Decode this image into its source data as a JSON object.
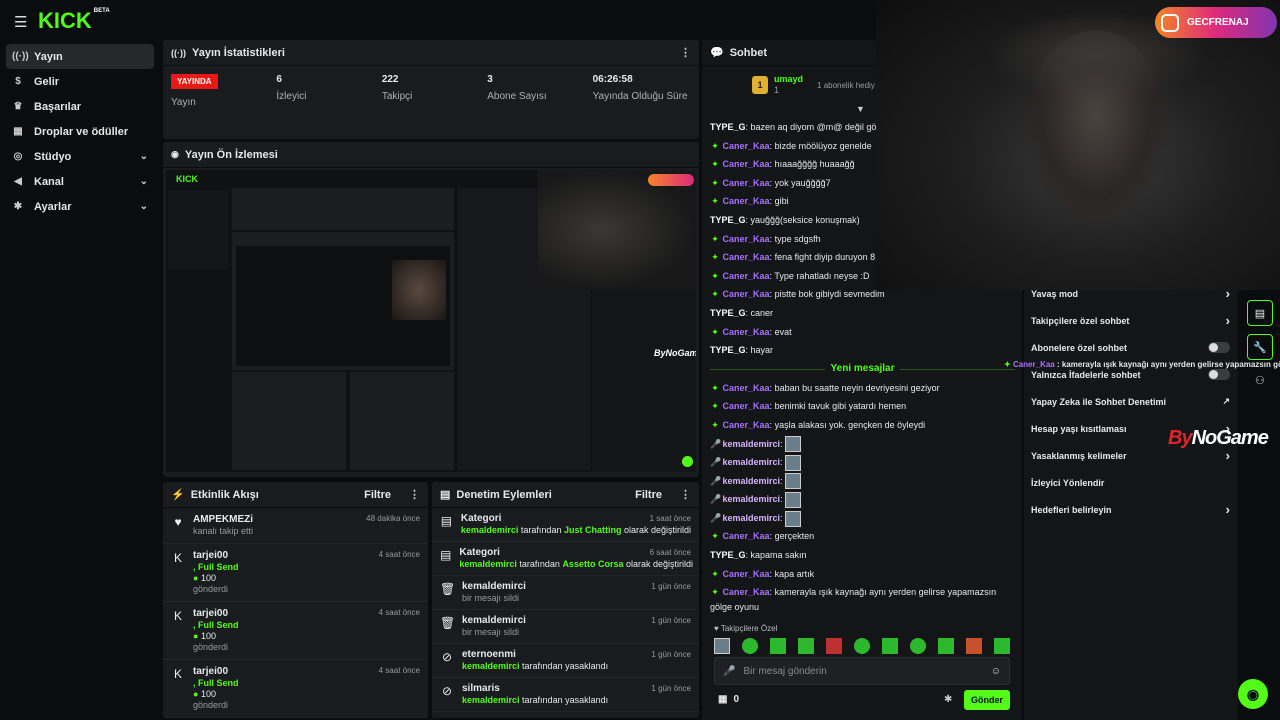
{
  "topbar": {
    "logo": "KICK",
    "logo_badge": "BETA"
  },
  "sidebar": {
    "items": [
      {
        "label": "Yayın",
        "icon": "broadcast-icon",
        "glyph": "((·))",
        "active": true,
        "chevron": false
      },
      {
        "label": "Gelir",
        "icon": "dollar-icon",
        "glyph": "$",
        "active": false,
        "chevron": false
      },
      {
        "label": "Başarılar",
        "icon": "trophy-icon",
        "glyph": "♛",
        "active": false,
        "chevron": false
      },
      {
        "label": "Droplar ve ödüller",
        "icon": "gift-icon",
        "glyph": "▦",
        "active": false,
        "chevron": false
      },
      {
        "label": "Stüdyo",
        "icon": "studio-icon",
        "glyph": "◎",
        "active": false,
        "chevron": true
      },
      {
        "label": "Kanal",
        "icon": "megaphone-icon",
        "glyph": "◀",
        "active": false,
        "chevron": true
      },
      {
        "label": "Ayarlar",
        "icon": "gear-icon",
        "glyph": "✱",
        "active": false,
        "chevron": true
      }
    ]
  },
  "stats": {
    "title": "Yayın İstatistikleri",
    "live_badge": "YAYINDA",
    "live_label": "Yayın",
    "items": [
      {
        "value": "6",
        "label": "İzleyici"
      },
      {
        "value": "222",
        "label": "Takipçi"
      },
      {
        "value": "3",
        "label": "Abone Sayısı"
      },
      {
        "value": "06:26:58",
        "label": "Yayında Olduğu Süre"
      }
    ]
  },
  "preview": {
    "title": "Yayın Ön İzlemesi"
  },
  "activity": {
    "title": "Etkinlik Akışı",
    "filter": "Filtre",
    "items": [
      {
        "name": "AMPEKMEZi",
        "line1": "kanalı takip etti",
        "line2": "",
        "line3": "",
        "time": "48 dakika önce",
        "icon": "heart-icon",
        "glyph": "♥"
      },
      {
        "name": "tarjei00",
        "line1": ", Full Send",
        "line2": "100",
        "line3": "gönderdi",
        "time": "4 saat önce",
        "icon": "kick-icon",
        "glyph": "K"
      },
      {
        "name": "tarjei00",
        "line1": ", Full Send",
        "line2": "100",
        "line3": "gönderdi",
        "time": "4 saat önce",
        "icon": "kick-icon",
        "glyph": "K"
      },
      {
        "name": "tarjei00",
        "line1": ", Full Send",
        "line2": "100",
        "line3": "gönderdi",
        "time": "4 saat önce",
        "icon": "kick-icon",
        "glyph": "K"
      }
    ]
  },
  "moderation": {
    "title": "Denetim Eylemleri",
    "filter": "Filtre",
    "items": [
      {
        "name": "Kategori",
        "user": "kemaldemirci",
        "mid": " tarafından ",
        "target": "Just Chatting",
        "tail": " olarak değiştirildi",
        "time": "1 saat önce",
        "icon": "category-icon",
        "glyph": "▤"
      },
      {
        "name": "Kategori",
        "user": "kemaldemirci",
        "mid": " tarafından ",
        "target": "Assetto Corsa",
        "tail": " olarak değiştirildi",
        "time": "6 saat önce",
        "icon": "category-icon",
        "glyph": "▤"
      },
      {
        "name": "kemaldemirci",
        "user": "",
        "mid": "bir mesajı sildi",
        "target": "",
        "tail": "",
        "time": "1 gün önce",
        "icon": "trash-icon",
        "glyph": "🗑"
      },
      {
        "name": "kemaldemirci",
        "user": "",
        "mid": "bir mesajı sildi",
        "target": "",
        "tail": "",
        "time": "1 gün önce",
        "icon": "trash-icon",
        "glyph": "🗑"
      },
      {
        "name": "eternoenmi",
        "user": "kemaldemirci",
        "mid": " tarafından yasaklandı",
        "target": "",
        "tail": "",
        "time": "1 gün önce",
        "icon": "ban-icon",
        "glyph": "⊘"
      },
      {
        "name": "silmaris",
        "user": "kemaldemirci",
        "mid": " tarafından yasaklandı",
        "target": "",
        "tail": "",
        "time": "1 gün önce",
        "icon": "ban-icon",
        "glyph": "⊘"
      }
    ]
  },
  "chat": {
    "title": "Sohbet",
    "pinned_user": "umayd",
    "pinned_count": "1",
    "pinned_text": "1 abonelik hediy",
    "new_messages": "Yeni mesajlar",
    "followers_only": "Takipçilere Özel",
    "input_placeholder": "Bir mesaj gönderin",
    "points": "0",
    "send": "Gönder",
    "messages_before": [
      {
        "user": "TYPE_G",
        "badge": "",
        "text": "bazen aq diyom @m@ değil göte",
        "color": "#ffffff"
      },
      {
        "user": "Caner_Kaa",
        "badge": "green",
        "text": "bizde möölüyoz genelde",
        "color": "#a970ff"
      },
      {
        "user": "Caner_Kaa",
        "badge": "green",
        "text": "hıaaağğğğ huaaağğ",
        "color": "#a970ff"
      },
      {
        "user": "Caner_Kaa",
        "badge": "green",
        "text": "yok yauğğğğ7",
        "color": "#a970ff"
      },
      {
        "user": "Caner_Kaa",
        "badge": "green",
        "text": "gibi",
        "color": "#a970ff"
      },
      {
        "user": "TYPE_G",
        "badge": "",
        "text": "yauğğğ(seksice konuşmak)",
        "color": "#ffffff"
      },
      {
        "user": "Caner_Kaa",
        "badge": "green",
        "text": "type sdgsfh",
        "color": "#a970ff"
      },
      {
        "user": "Caner_Kaa",
        "badge": "green",
        "text": "fena fight diyip duruyon 8",
        "color": "#a970ff"
      },
      {
        "user": "Caner_Kaa",
        "badge": "green",
        "text": "Type rahatladı neyse :D",
        "color": "#a970ff"
      },
      {
        "user": "Caner_Kaa",
        "badge": "green",
        "text": "pistte bok gibiydi sevmedim",
        "color": "#a970ff"
      },
      {
        "user": "TYPE_G",
        "badge": "",
        "text": "caner",
        "color": "#ffffff"
      },
      {
        "user": "Caner_Kaa",
        "badge": "green",
        "text": "evat",
        "color": "#a970ff"
      },
      {
        "user": "TYPE_G",
        "badge": "",
        "text": "hayar",
        "color": "#ffffff"
      }
    ],
    "messages_after": [
      {
        "user": "Caner_Kaa",
        "badge": "green",
        "text": "baban bu saatte neyin devriyesini geziyor",
        "color": "#a970ff"
      },
      {
        "user": "Caner_Kaa",
        "badge": "green",
        "text": "benimki tavuk gibi yatardı hemen",
        "color": "#a970ff"
      },
      {
        "user": "Caner_Kaa",
        "badge": "green",
        "text": "yaşla alakası yok. gençken de öyleydi",
        "color": "#a970ff"
      },
      {
        "user": "kemaldemirci",
        "badge": "mic",
        "text": "",
        "color": "#d6b3ff",
        "emote": true
      },
      {
        "user": "kemaldemirci",
        "badge": "mic",
        "text": "",
        "color": "#d6b3ff",
        "emote": true
      },
      {
        "user": "kemaldemirci",
        "badge": "mic",
        "text": "",
        "color": "#d6b3ff",
        "emote": true
      },
      {
        "user": "kemaldemirci",
        "badge": "mic",
        "text": "",
        "color": "#d6b3ff",
        "emote": true
      },
      {
        "user": "kemaldemirci",
        "badge": "mic",
        "text": "",
        "color": "#d6b3ff",
        "emote": true
      },
      {
        "user": "Caner_Kaa",
        "badge": "green",
        "text": "gerçekten",
        "color": "#a970ff"
      },
      {
        "user": "TYPE_G",
        "badge": "",
        "text": "kapama sakın",
        "color": "#ffffff"
      },
      {
        "user": "Caner_Kaa",
        "badge": "green",
        "text": "kapa artık",
        "color": "#a970ff"
      },
      {
        "user": "Caner_Kaa",
        "badge": "green",
        "text": "kamerayla ışık kaynağı aynı yerden gelirse yapamazsın",
        "color": "#a970ff"
      }
    ],
    "wrap_tail": "gölge oyunu"
  },
  "chat_settings": {
    "items": [
      {
        "label": "Yavaş mod",
        "control": "chevron"
      },
      {
        "label": "Takipçilere özel sohbet",
        "control": "chevron"
      },
      {
        "label": "Abonelere özel sohbet",
        "control": "toggle"
      },
      {
        "label": "Yalnızca İfadelerle sohbet",
        "control": "toggle"
      },
      {
        "label": "Yapay Zeka ile Sohbet Denetimi",
        "control": "external"
      },
      {
        "label": "Hesap yaşı kısıtlaması",
        "control": "chevron"
      },
      {
        "label": "Yasaklanmış kelimeler",
        "control": "chevron"
      },
      {
        "label": "İzleyici Yönlendir",
        "control": "none"
      },
      {
        "label": "Hedefleri belirleyin",
        "control": "chevron"
      }
    ]
  },
  "overlay": {
    "instagram_handle": "GECFRENAJ",
    "sponsor": "ByNoGame",
    "sponsor_prefix": "By",
    "sponsor_rest": "NoGame",
    "overlay_user": "Caner_Kaa",
    "overlay_text": "kamerayla ışık kaynağı aynı yerden gelirse yapamazsın gölge oyunu"
  },
  "colors": {
    "accent": "#53fc18",
    "live": "#e91916",
    "bg": "#0b0c0d",
    "panel": "#191b1f"
  }
}
